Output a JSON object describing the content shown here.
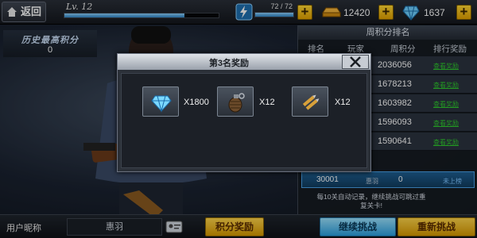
{
  "topbar": {
    "back_label": "返回",
    "level": "Lv. 12",
    "level_progress": 0.78,
    "stamina": "72 / 72",
    "stamina_progress": 1.0,
    "gold": "12420",
    "diamonds": "1637"
  },
  "best_score": {
    "title": "历史最高积分",
    "value": "0"
  },
  "leaderboard": {
    "title": "周积分排名",
    "columns": [
      "排名",
      "玩家",
      "周积分",
      "排行奖励"
    ],
    "rows": [
      {
        "score": "2036056",
        "reward": "查看奖励"
      },
      {
        "score": "1678213",
        "reward": "查看奖励"
      },
      {
        "score": "1603982",
        "reward": "查看奖励"
      },
      {
        "score": "1596093",
        "reward": "查看奖励"
      },
      {
        "score": "1590641",
        "reward": "查看奖励"
      }
    ],
    "my_rank": {
      "rank": "30001",
      "name": "惠羽",
      "score": "0",
      "status": "未上榜"
    },
    "note": "每10关自动记录，继续挑战可跳过重复关卡!"
  },
  "bottom": {
    "nickname_label": "用户昵称",
    "nickname": "惠羽",
    "score_reward_btn": "积分奖励",
    "continue_btn": "继续挑战",
    "restart_btn": "重新挑战"
  },
  "dialog": {
    "title": "第3名奖励",
    "items": [
      {
        "icon": "diamond-icon",
        "qty": "X1800"
      },
      {
        "icon": "grenade-icon",
        "qty": "X12"
      },
      {
        "icon": "ammo-icon",
        "qty": "X12"
      }
    ]
  },
  "colors": {
    "accent_blue": "#2aa0e0",
    "accent_gold": "#e3a200",
    "link_green": "#2ec92e"
  }
}
